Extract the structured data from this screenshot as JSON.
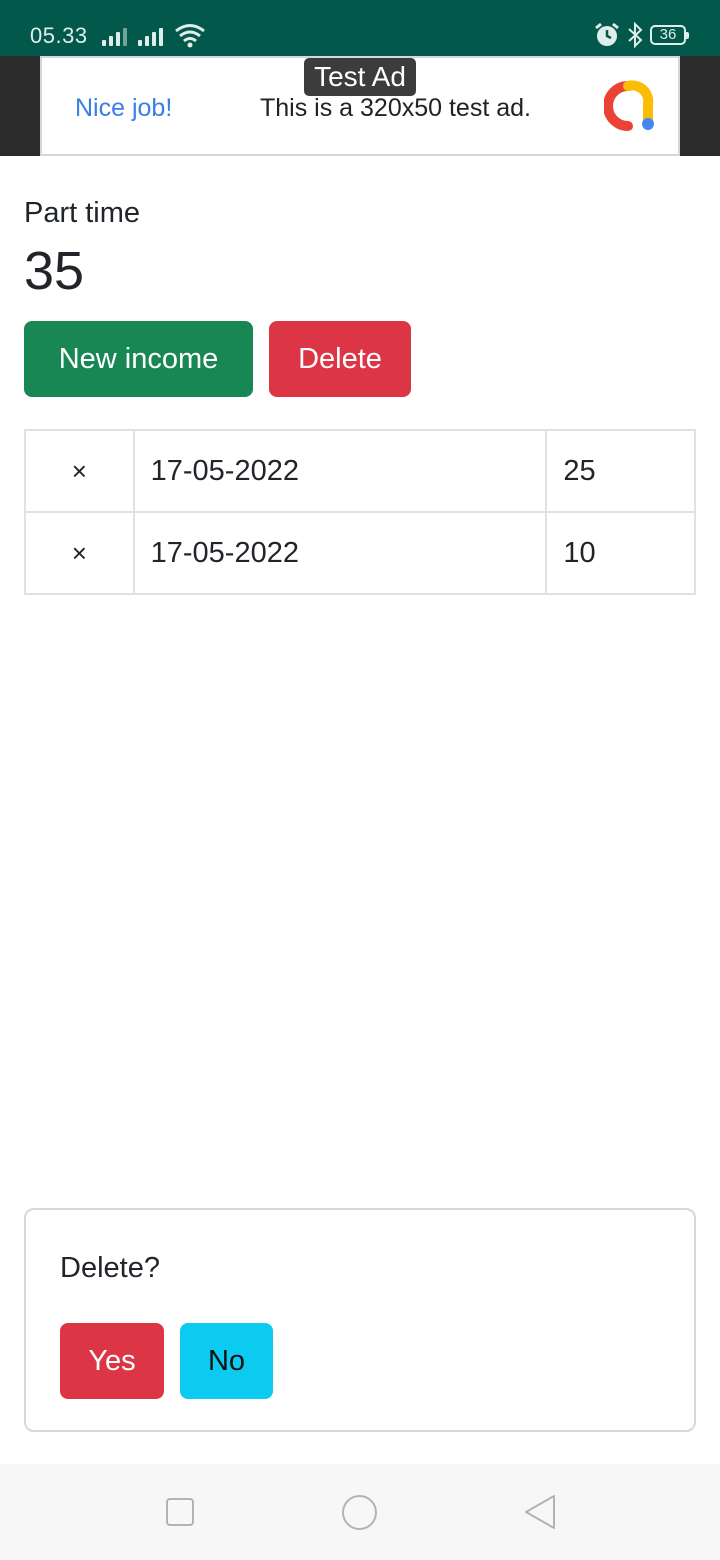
{
  "status_bar": {
    "time": "05.33",
    "battery": "36",
    "icons": [
      "signal-icon",
      "signal-icon",
      "wifi-icon",
      "alarm-icon",
      "bluetooth-icon",
      "battery-icon"
    ]
  },
  "ad": {
    "badge": "Test Ad",
    "headline": "Nice job!",
    "body": "This is a 320x50 test ad.",
    "logo_icon": "adsense-logo-icon"
  },
  "income": {
    "label": "Part time",
    "total": "35"
  },
  "actions": {
    "new_income_label": "New income",
    "delete_label": "Delete"
  },
  "table": {
    "rows": [
      {
        "remove": "×",
        "date": "17-05-2022",
        "amount": "25"
      },
      {
        "remove": "×",
        "date": "17-05-2022",
        "amount": "10"
      }
    ]
  },
  "confirm": {
    "question": "Delete?",
    "yes_label": "Yes",
    "no_label": "No"
  },
  "colors": {
    "status_bar": "#02584b",
    "success": "#198754",
    "danger": "#dc3545",
    "info": "#0dcaf0"
  },
  "nav": {
    "icons": [
      "recent-apps-icon",
      "home-icon",
      "back-icon"
    ]
  }
}
